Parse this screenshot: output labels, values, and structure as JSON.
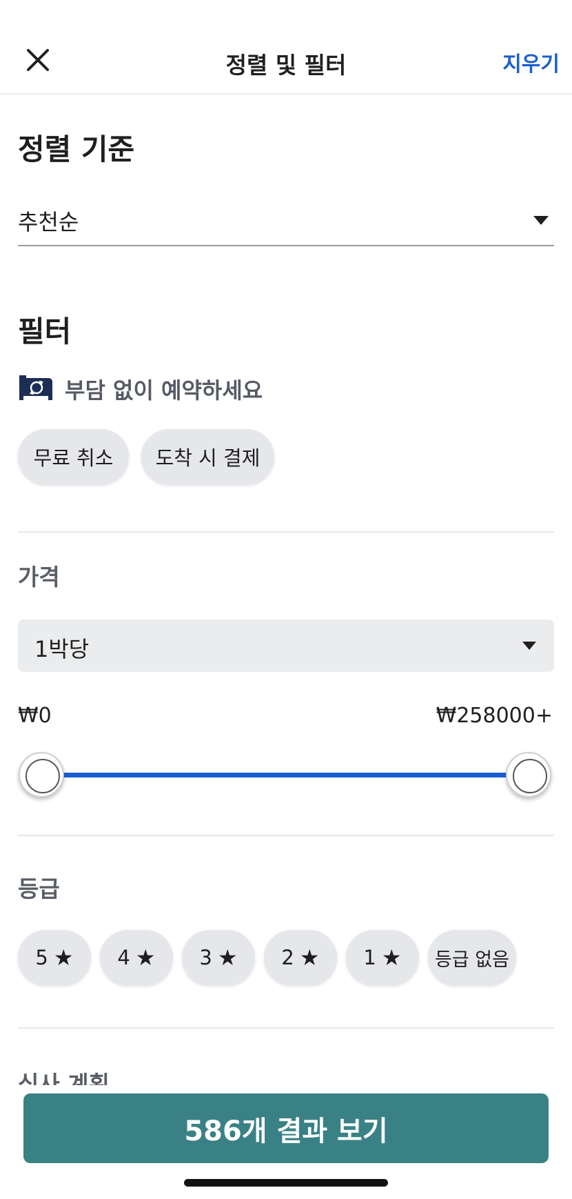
{
  "header": {
    "title": "정렬 및 필터",
    "clear_label": "지우기"
  },
  "sort": {
    "title": "정렬 기준",
    "selected": "추천순"
  },
  "filter": {
    "title": "필터",
    "book_without_worry": "부담 없이 예약하세요",
    "chips": [
      "무료 취소",
      "도착 시 결제"
    ]
  },
  "price": {
    "label": "가격",
    "per_option": "1박당",
    "min_label": "₩0",
    "max_label": "₩258000+",
    "range_fraction": [
      0,
      1
    ]
  },
  "rating": {
    "label": "등급",
    "options": [
      "5",
      "4",
      "3",
      "2",
      "1"
    ],
    "unrated": "등급 없음"
  },
  "meal_plan": {
    "label": "식사 계획"
  },
  "cta": {
    "label": "586개 결과 보기"
  },
  "colors": {
    "accent": "#1a5fd0",
    "cta": "#3a8185",
    "chip": "#e6e7ea"
  }
}
